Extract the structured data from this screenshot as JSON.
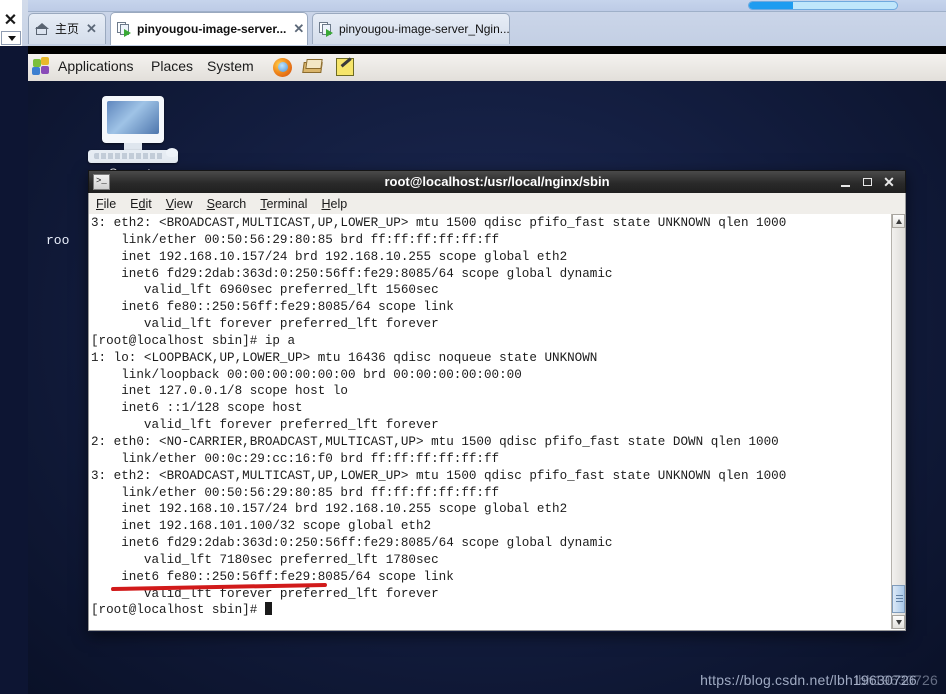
{
  "browser": {
    "left_rail": {
      "close_icon": "✕"
    },
    "tabs": [
      {
        "label": "主页",
        "icon": "home-icon",
        "active": false,
        "close": "✕"
      },
      {
        "label": "pinyougou-image-server...",
        "icon": "page-window-icon",
        "active": true,
        "close": "✕"
      },
      {
        "label": "pinyougou-image-server_Ngin...",
        "icon": "page-window-icon",
        "active": false,
        "close": "✕"
      }
    ]
  },
  "panel": {
    "menus": [
      "Applications",
      "Places",
      "System"
    ],
    "launchers": [
      "firefox-icon",
      "book-icon",
      "text-editor-icon"
    ],
    "apps_icon": "applications-puzzle-icon"
  },
  "desktop": {
    "icon_label": "Computer",
    "icon_name": "computer-icon",
    "occluded_text": "roo",
    "watermark": "https://blog.csdn.net/lbh19630726",
    "watermark_ghost": "lbh19630726"
  },
  "terminal": {
    "title": "root@localhost:/usr/local/nginx/sbin",
    "window_icon": "terminal-icon",
    "controls": {
      "minimize": "–",
      "maximize": "□",
      "close": "✕"
    },
    "menubar": [
      "File",
      "Edit",
      "View",
      "Search",
      "Terminal",
      "Help"
    ],
    "annotation": {
      "type": "red-underline",
      "color": "#d11a1a",
      "target": "inet 192.168.101.100/32"
    },
    "scrollbar": {
      "up_arrow": "▲",
      "down_arrow": "▼",
      "thumb_position": "bottom"
    },
    "content": "3: eth2: <BROADCAST,MULTICAST,UP,LOWER_UP> mtu 1500 qdisc pfifo_fast state UNKNOWN qlen 1000\n    link/ether 00:50:56:29:80:85 brd ff:ff:ff:ff:ff:ff\n    inet 192.168.10.157/24 brd 192.168.10.255 scope global eth2\n    inet6 fd29:2dab:363d:0:250:56ff:fe29:8085/64 scope global dynamic\n       valid_lft 6960sec preferred_lft 1560sec\n    inet6 fe80::250:56ff:fe29:8085/64 scope link\n       valid_lft forever preferred_lft forever\n[root@localhost sbin]# ip a\n1: lo: <LOOPBACK,UP,LOWER_UP> mtu 16436 qdisc noqueue state UNKNOWN\n    link/loopback 00:00:00:00:00:00 brd 00:00:00:00:00:00\n    inet 127.0.0.1/8 scope host lo\n    inet6 ::1/128 scope host\n       valid_lft forever preferred_lft forever\n2: eth0: <NO-CARRIER,BROADCAST,MULTICAST,UP> mtu 1500 qdisc pfifo_fast state DOWN qlen 1000\n    link/ether 00:0c:29:cc:16:f0 brd ff:ff:ff:ff:ff:ff\n3: eth2: <BROADCAST,MULTICAST,UP,LOWER_UP> mtu 1500 qdisc pfifo_fast state UNKNOWN qlen 1000\n    link/ether 00:50:56:29:80:85 brd ff:ff:ff:ff:ff:ff\n    inet 192.168.10.157/24 brd 192.168.10.255 scope global eth2\n    inet 192.168.101.100/32 scope global eth2\n    inet6 fd29:2dab:363d:0:250:56ff:fe29:8085/64 scope global dynamic\n       valid_lft 7180sec preferred_lft 1780sec\n    inet6 fe80::250:56ff:fe29:8085/64 scope link\n       valid_lft forever preferred_lft forever\n[root@localhost sbin]# ",
    "prompt_last": "[root@localhost sbin]# "
  }
}
